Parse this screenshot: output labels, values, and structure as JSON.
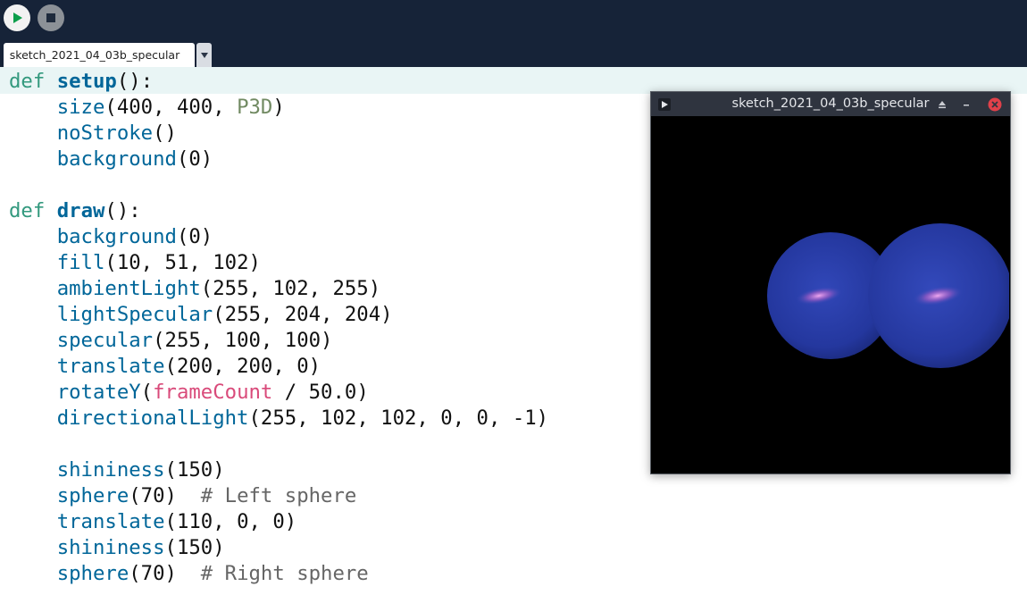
{
  "toolbar": {
    "run_icon": "play-icon",
    "stop_icon": "stop-icon"
  },
  "tabs": [
    {
      "label": "sketch_2021_04_03b_specular",
      "active": true
    }
  ],
  "tab_menu_icon": "chevron-down-icon",
  "editor": {
    "lines": [
      [
        {
          "t": "def",
          "c": "kw"
        },
        {
          "t": " ",
          "c": "plain"
        },
        {
          "t": "setup",
          "c": "def-name"
        },
        {
          "t": "():",
          "c": "plain"
        }
      ],
      [
        {
          "t": "    ",
          "c": "plain"
        },
        {
          "t": "size",
          "c": "fn"
        },
        {
          "t": "(400, 400, ",
          "c": "plain"
        },
        {
          "t": "P3D",
          "c": "const"
        },
        {
          "t": ")",
          "c": "plain"
        }
      ],
      [
        {
          "t": "    ",
          "c": "plain"
        },
        {
          "t": "noStroke",
          "c": "fn"
        },
        {
          "t": "()",
          "c": "plain"
        }
      ],
      [
        {
          "t": "    ",
          "c": "plain"
        },
        {
          "t": "background",
          "c": "fn"
        },
        {
          "t": "(0)",
          "c": "plain"
        }
      ],
      [],
      [
        {
          "t": "def",
          "c": "kw"
        },
        {
          "t": " ",
          "c": "plain"
        },
        {
          "t": "draw",
          "c": "def-name"
        },
        {
          "t": "():",
          "c": "plain"
        }
      ],
      [
        {
          "t": "    ",
          "c": "plain"
        },
        {
          "t": "background",
          "c": "fn"
        },
        {
          "t": "(0)",
          "c": "plain"
        }
      ],
      [
        {
          "t": "    ",
          "c": "plain"
        },
        {
          "t": "fill",
          "c": "fn"
        },
        {
          "t": "(10, 51, 102)",
          "c": "plain"
        }
      ],
      [
        {
          "t": "    ",
          "c": "plain"
        },
        {
          "t": "ambientLight",
          "c": "fn"
        },
        {
          "t": "(255, 102, 255)",
          "c": "plain"
        }
      ],
      [
        {
          "t": "    ",
          "c": "plain"
        },
        {
          "t": "lightSpecular",
          "c": "fn"
        },
        {
          "t": "(255, 204, 204)",
          "c": "plain"
        }
      ],
      [
        {
          "t": "    ",
          "c": "plain"
        },
        {
          "t": "specular",
          "c": "fn"
        },
        {
          "t": "(255, 100, 100)",
          "c": "plain"
        }
      ],
      [
        {
          "t": "    ",
          "c": "plain"
        },
        {
          "t": "translate",
          "c": "fn"
        },
        {
          "t": "(200, 200, 0)",
          "c": "plain"
        }
      ],
      [
        {
          "t": "    ",
          "c": "plain"
        },
        {
          "t": "rotateY",
          "c": "fn"
        },
        {
          "t": "(",
          "c": "plain"
        },
        {
          "t": "frameCount",
          "c": "var"
        },
        {
          "t": " / 50.0)",
          "c": "plain"
        }
      ],
      [
        {
          "t": "    ",
          "c": "plain"
        },
        {
          "t": "directionalLight",
          "c": "fn"
        },
        {
          "t": "(255, 102, 102, 0, 0, -1)",
          "c": "plain"
        }
      ],
      [],
      [
        {
          "t": "    ",
          "c": "plain"
        },
        {
          "t": "shininess",
          "c": "fn"
        },
        {
          "t": "(150)",
          "c": "plain"
        }
      ],
      [
        {
          "t": "    ",
          "c": "plain"
        },
        {
          "t": "sphere",
          "c": "fn"
        },
        {
          "t": "(70)  ",
          "c": "plain"
        },
        {
          "t": "# Left sphere",
          "c": "comment"
        }
      ],
      [
        {
          "t": "    ",
          "c": "plain"
        },
        {
          "t": "translate",
          "c": "fn"
        },
        {
          "t": "(110, 0, 0)",
          "c": "plain"
        }
      ],
      [
        {
          "t": "    ",
          "c": "plain"
        },
        {
          "t": "shininess",
          "c": "fn"
        },
        {
          "t": "(150)",
          "c": "plain"
        }
      ],
      [
        {
          "t": "    ",
          "c": "plain"
        },
        {
          "t": "sphere",
          "c": "fn"
        },
        {
          "t": "(70)  ",
          "c": "plain"
        },
        {
          "t": "# Right sphere",
          "c": "comment"
        }
      ]
    ]
  },
  "sketch_window": {
    "title": "sketch_2021_04_03b_specular",
    "app_icon": "processing-icon",
    "buttons": [
      "eject-icon",
      "minimize-icon",
      "close-icon"
    ],
    "colors": {
      "sphere": "#24379e",
      "highlight": "#d07ad0",
      "background": "#000000"
    }
  },
  "colors": {
    "toolbar_bg": "#162338",
    "keyword": "#33997e",
    "function": "#006699",
    "constant": "#718a62",
    "variable": "#d94a7a",
    "comment": "#666666",
    "current_line": "#e9f5f5"
  }
}
